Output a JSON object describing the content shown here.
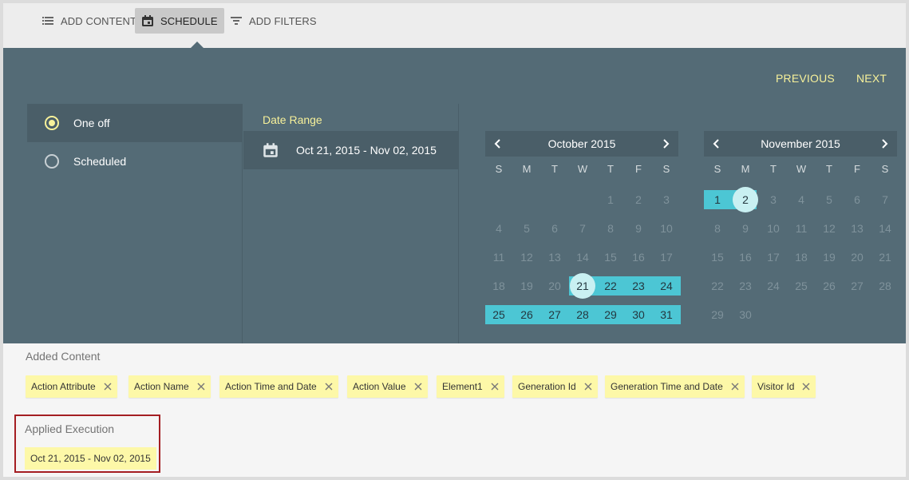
{
  "toolbar": {
    "add_content": "ADD CONTENT",
    "schedule": "SCHEDULE",
    "add_filters": "ADD FILTERS"
  },
  "nav": {
    "previous": "PREVIOUS",
    "next": "NEXT"
  },
  "mode": {
    "options": [
      {
        "label": "One off",
        "selected": true
      },
      {
        "label": "Scheduled",
        "selected": false
      }
    ]
  },
  "date_range": {
    "title": "Date Range",
    "value": "Oct 21, 2015 - Nov 02, 2015"
  },
  "weekdays": [
    "S",
    "M",
    "T",
    "W",
    "T",
    "F",
    "S"
  ],
  "calendars": [
    {
      "title": "October 2015",
      "first_weekday": 4,
      "days_in_month": 31,
      "range_start": 21,
      "range_end": 31,
      "highlight_day": 21
    },
    {
      "title": "November 2015",
      "first_weekday": 0,
      "days_in_month": 30,
      "range_start": 1,
      "range_end": 2,
      "highlight_day": 2
    }
  ],
  "added_content": {
    "title": "Added Content",
    "chips": [
      "Action Attribute",
      "Action Name",
      "Action Time and Date",
      "Action Value",
      "Element1",
      "Generation Id",
      "Generation Time and Date",
      "Visitor Id"
    ]
  },
  "applied_execution": {
    "title": "Applied Execution",
    "value": "Oct 21, 2015 - Nov 02, 2015"
  },
  "colors": {
    "panel": "#546b76",
    "accent_yellow": "#f7f19a",
    "range_band": "#4cc6d4",
    "chip_bg": "#fdf8a8",
    "highlight_border": "#a41e22"
  },
  "icons": [
    "list-icon",
    "calendar-icon",
    "filter-icon",
    "chevron-left-icon",
    "chevron-right-icon",
    "close-icon",
    "radio-icon"
  ]
}
